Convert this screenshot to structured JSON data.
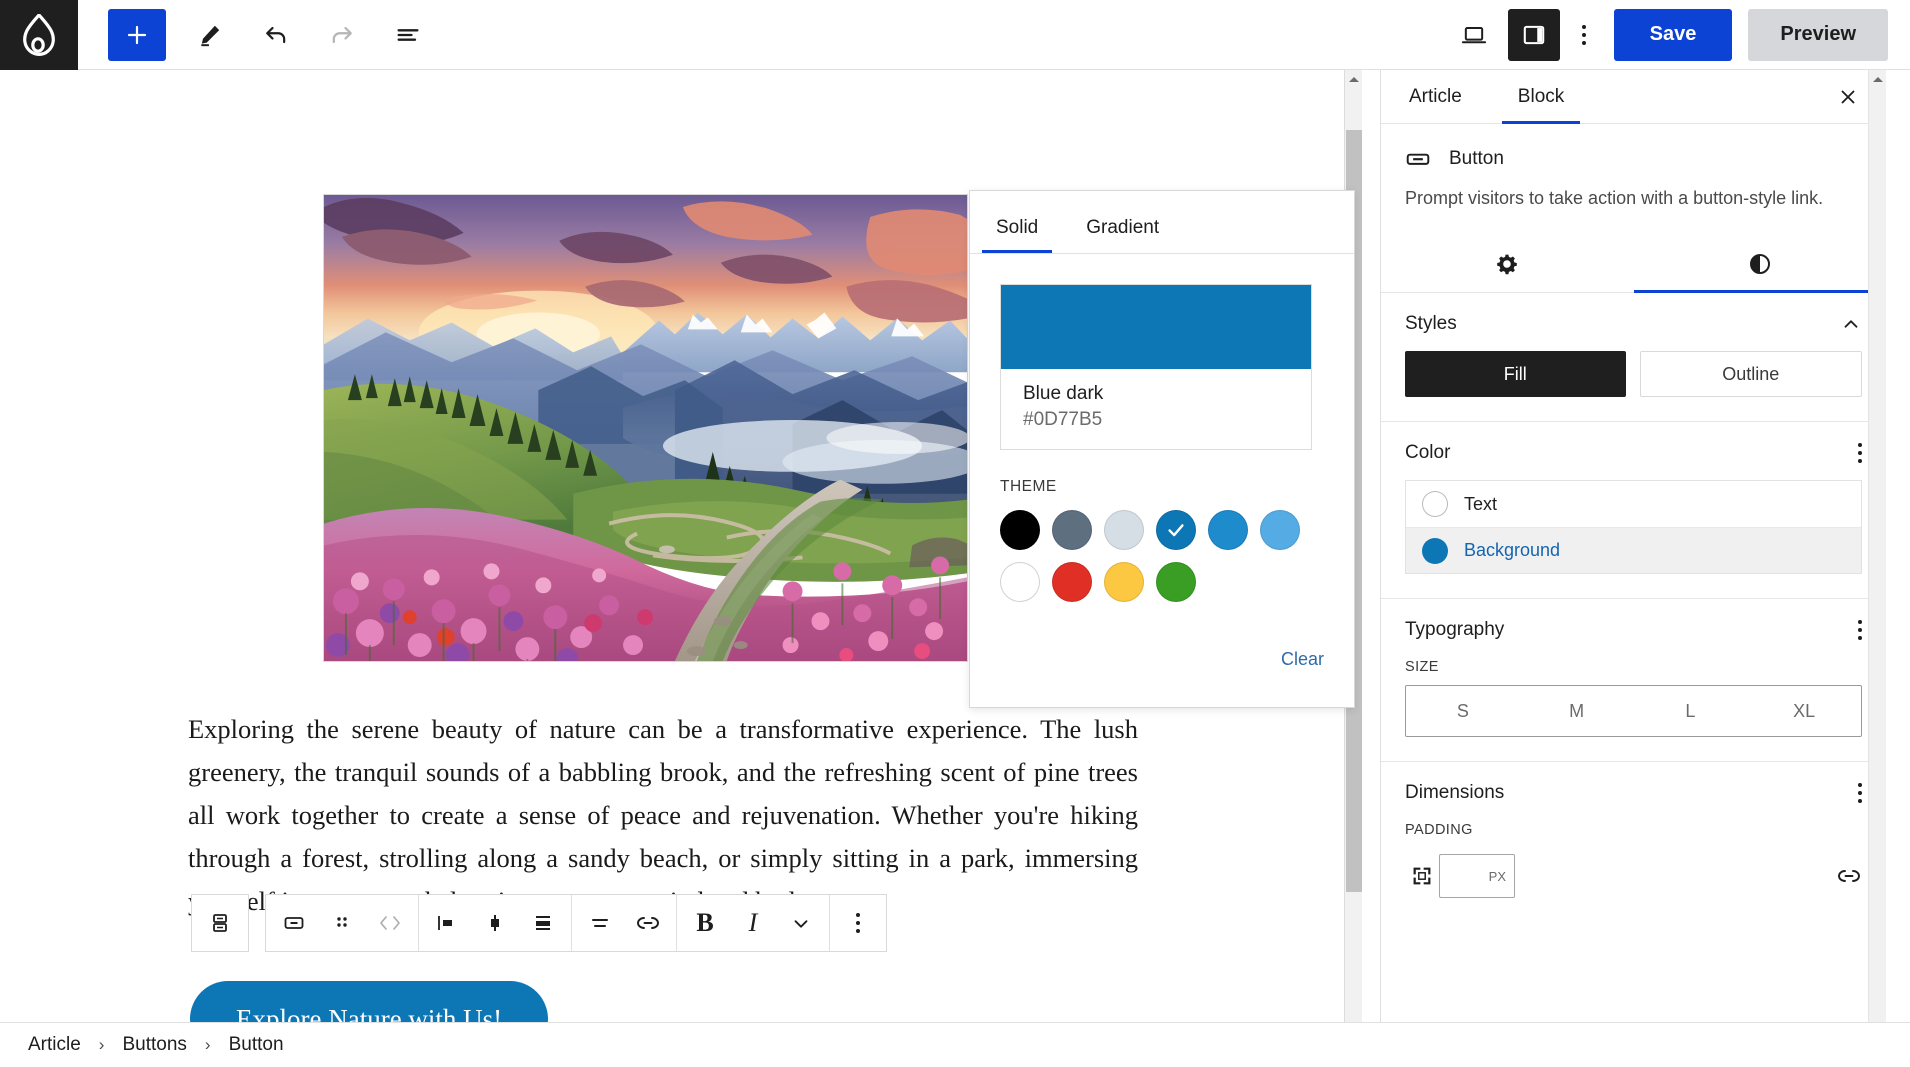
{
  "topbar": {
    "logo_icon": "drupal-drop-logo",
    "add_block_label": "+",
    "add_block_icon": "plus-icon",
    "pencil_icon": "pencil-edit-icon",
    "undo_icon": "undo-arrow-icon",
    "redo_icon": "redo-arrow-icon",
    "listview_icon": "list-view-icon",
    "device_icon": "laptop-preview-icon",
    "sidebar_toggle_icon": "sidebar-panel-icon",
    "more_icon": "more-vertical-icon",
    "save_label": "Save",
    "preview_label": "Preview",
    "save_color": "#0D43D4",
    "preview_color": "#D5D7DB"
  },
  "canvas": {
    "image_alt": "Mountain sunset landscape with pink wildflowers and winding path",
    "paragraph": "Exploring the serene beauty of nature can be a transformative experience. The lush greenery, the tranquil sounds of a babbling brook, and the refreshing scent of pine trees all work together to create a sense of peace and rejuvenation. Whether you're hiking through a forest, strolling along a sandy beach, or simply sitting in a park, immersing yourself in nature can help rejuvenate your mind and body.",
    "button_label": "Explore Nature with Us!",
    "button_color": "#0D77B5"
  },
  "block_toolbar": {
    "parent_select_icon": "select-parent-block-icon",
    "items": [
      {
        "icon": "button-block-icon",
        "name": "block-type-button",
        "disabled": false
      },
      {
        "icon": "drag-handle-icon",
        "name": "drag-handle",
        "disabled": false
      },
      {
        "icon": "move-arrows-icon",
        "name": "move-block",
        "disabled": true
      },
      {
        "icon": "align-left-icon",
        "name": "align-left",
        "disabled": false
      },
      {
        "icon": "align-center-icon",
        "name": "align-center",
        "disabled": false
      },
      {
        "icon": "align-right-icon",
        "name": "align-right",
        "disabled": false
      },
      {
        "icon": "text-align-icon",
        "name": "change-text-alignment",
        "disabled": false
      },
      {
        "icon": "link-icon",
        "name": "insert-link",
        "disabled": false
      },
      {
        "icon": "bold-icon",
        "name": "bold",
        "disabled": false
      },
      {
        "icon": "italic-icon",
        "name": "italic",
        "disabled": false
      },
      {
        "icon": "chevron-down-icon",
        "name": "more-rich-text-options",
        "disabled": false
      },
      {
        "icon": "more-vertical-icon",
        "name": "block-options",
        "disabled": false
      }
    ]
  },
  "color_popover": {
    "tabs": [
      {
        "label": "Solid",
        "active": true
      },
      {
        "label": "Gradient",
        "active": false
      }
    ],
    "selected": {
      "name": "Blue dark",
      "hex": "#0D77B5"
    },
    "theme_label": "THEME",
    "clear_label": "Clear",
    "swatches": [
      {
        "name": "Black",
        "hex": "#000000",
        "selected": false
      },
      {
        "name": "Slate gray",
        "hex": "#5E6F80",
        "selected": false
      },
      {
        "name": "Light gray",
        "hex": "#D6DEE5",
        "selected": false
      },
      {
        "name": "Blue dark",
        "hex": "#0D77B5",
        "selected": true
      },
      {
        "name": "Blue",
        "hex": "#1E8BCD",
        "selected": false
      },
      {
        "name": "Blue light",
        "hex": "#55ACE5",
        "selected": false
      },
      {
        "name": "White",
        "hex": "#FFFFFF",
        "selected": false
      },
      {
        "name": "Red",
        "hex": "#E03025",
        "selected": false
      },
      {
        "name": "Yellow",
        "hex": "#FCC741",
        "selected": false
      },
      {
        "name": "Green",
        "hex": "#3A9E25",
        "selected": false
      }
    ]
  },
  "sidebar": {
    "tabs": [
      {
        "label": "Article",
        "active": false
      },
      {
        "label": "Block",
        "active": true
      }
    ],
    "close_icon": "close-x-icon",
    "block": {
      "icon": "button-block-icon",
      "title": "Button",
      "description": "Prompt visitors to take action with a button-style link."
    },
    "icon_tabs": [
      {
        "icon": "gear-icon",
        "name": "tab-settings",
        "active": false
      },
      {
        "icon": "contrast-icon",
        "name": "tab-styles",
        "active": true
      }
    ],
    "styles": {
      "title": "Styles",
      "collapse_icon": "chevron-up-icon",
      "options": [
        {
          "label": "Fill",
          "active": true
        },
        {
          "label": "Outline",
          "active": false
        }
      ]
    },
    "color": {
      "title": "Color",
      "options_icon": "more-vertical-icon",
      "rows": [
        {
          "label": "Text",
          "hex": null,
          "selected": false
        },
        {
          "label": "Background",
          "hex": "#0D77B5",
          "selected": true
        }
      ]
    },
    "typography": {
      "title": "Typography",
      "options_icon": "more-vertical-icon",
      "size_label": "SIZE",
      "sizes": [
        "S",
        "M",
        "L",
        "XL"
      ]
    },
    "dimensions": {
      "title": "Dimensions",
      "options_icon": "more-vertical-icon",
      "padding_label": "PADDING",
      "padding_icon": "padding-box-icon",
      "padding_value": "",
      "padding_unit": "PX",
      "link_icon": "link-sides-icon"
    }
  },
  "breadcrumb": {
    "items": [
      "Article",
      "Buttons",
      "Button"
    ],
    "separator": "›"
  }
}
